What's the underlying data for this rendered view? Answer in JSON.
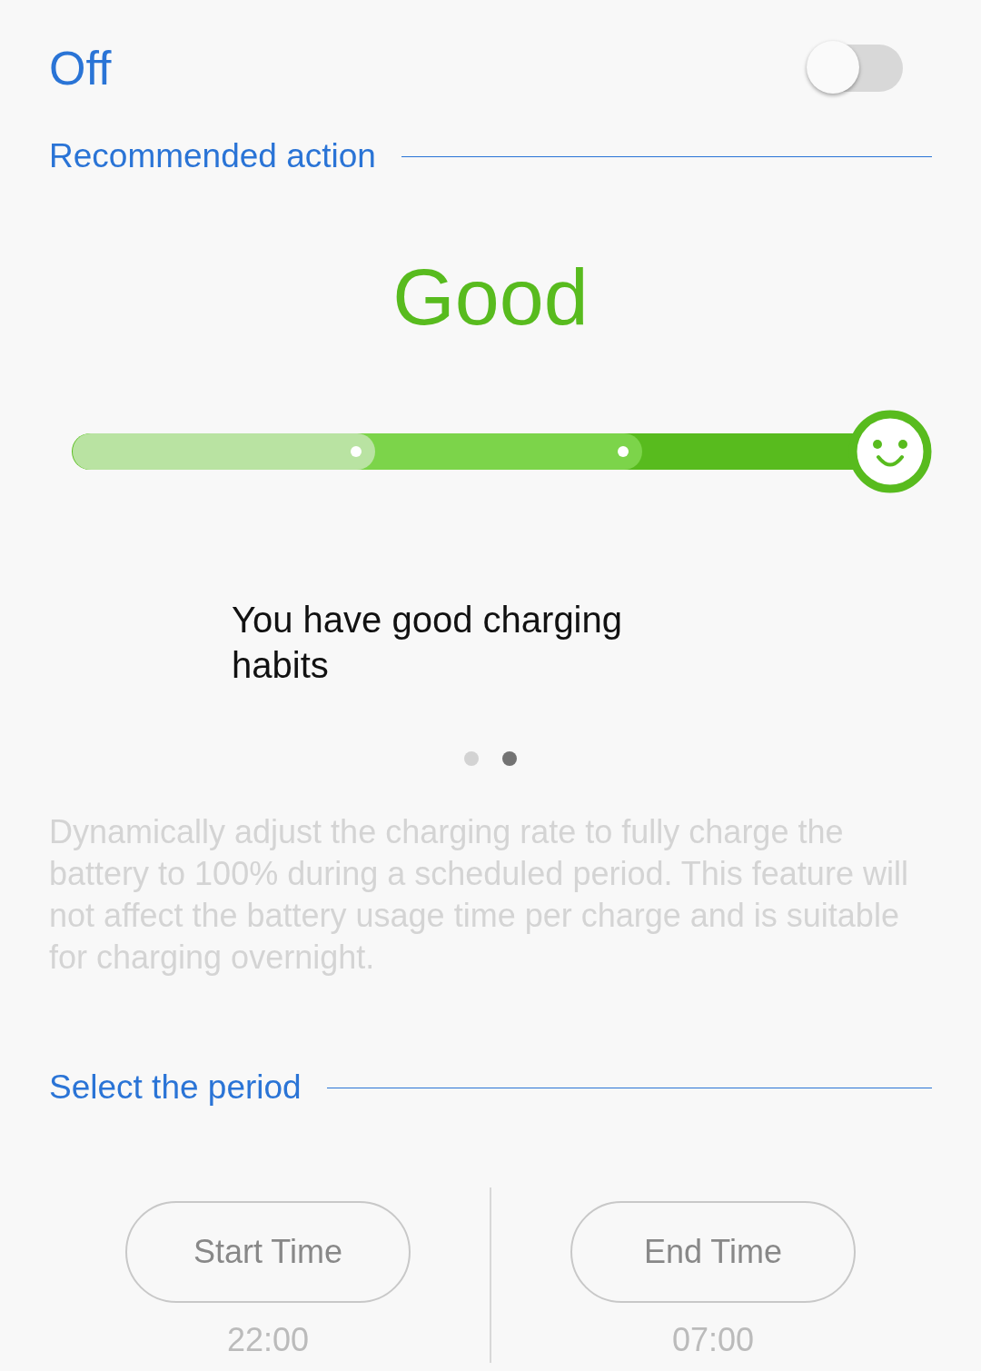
{
  "master_switch": {
    "label": "Off",
    "on": false
  },
  "recommended_section": {
    "title": "Recommended action"
  },
  "status": {
    "rating": "Good",
    "message": "You have good charging habits"
  },
  "pager": [
    {
      "selected": false
    },
    {
      "selected": true
    }
  ],
  "description": {
    "text": "Dynamically adjust the charging rate to fully charge the battery to 100% during a scheduled period. This feature will not affect the battery usage time per charge and is suitable for charging overnight.",
    "disabled": true
  },
  "period_section": {
    "title": "Select the period"
  },
  "period": [
    {
      "label": "Start Time",
      "value": "22:00",
      "disabled": true
    },
    {
      "label": "End Time",
      "value": "07:00",
      "disabled": true
    }
  ]
}
